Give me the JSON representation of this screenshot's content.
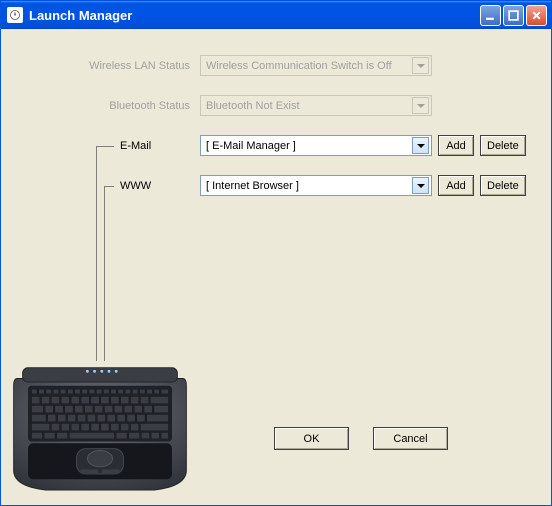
{
  "window": {
    "title": "Launch Manager"
  },
  "rows": {
    "wlan": {
      "label": "Wireless LAN Status",
      "value": "Wireless Communication Switch is Off"
    },
    "bt": {
      "label": "Bluetooth Status",
      "value": "Bluetooth Not Exist"
    },
    "email": {
      "label": "E-Mail",
      "value": "[  E-Mail Manager  ]",
      "add": "Add",
      "delete": "Delete"
    },
    "www": {
      "label": "WWW",
      "value": "[  Internet Browser  ]",
      "add": "Add",
      "delete": "Delete"
    }
  },
  "buttons": {
    "ok": "OK",
    "cancel": "Cancel"
  }
}
